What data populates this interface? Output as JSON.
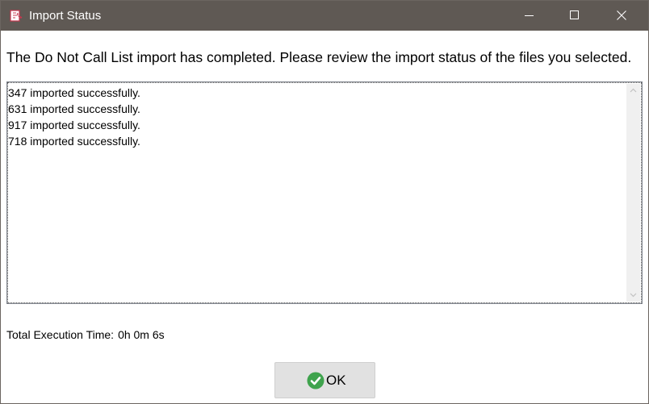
{
  "window": {
    "title": "Import Status",
    "controls": {
      "minimize": "minimize-icon",
      "maximize": "maximize-icon",
      "close": "close-icon"
    },
    "app_icon": "phone-list-icon"
  },
  "message": "The Do Not Call List import has completed. Please review the import status of the files you selected.",
  "status": {
    "lines": [
      "347 imported successfully.",
      "631 imported successfully.",
      "917 imported successfully.",
      "718 imported successfully."
    ]
  },
  "execution": {
    "label": "Total Execution Time:",
    "value": "0h 0m 6s"
  },
  "ok_button": {
    "label": "OK",
    "icon": "check-circle-icon"
  },
  "colors": {
    "titlebar": "#5f5954",
    "ok_check": "#3fa34d",
    "app_icon": "#c8384f"
  }
}
